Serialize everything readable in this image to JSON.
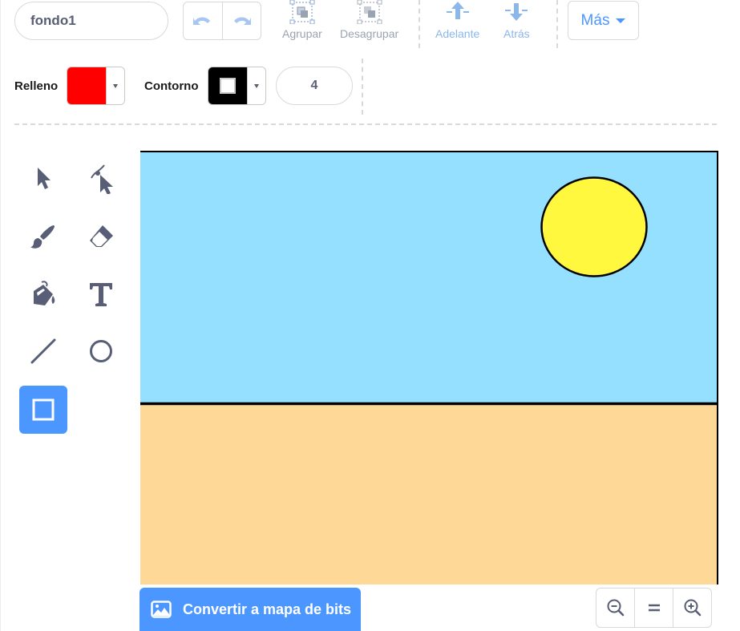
{
  "costume": {
    "name": "fondo1"
  },
  "toolbar": {
    "undo_icon": "undo-icon",
    "redo_icon": "redo-icon",
    "group_label": "Agrupar",
    "ungroup_label": "Desagrupar",
    "forward_label": "Adelante",
    "backward_label": "Atrás",
    "more_label": "Más"
  },
  "style": {
    "fill_label": "Relleno",
    "fill_color": "#ff0000",
    "outline_label": "Contorno",
    "outline_color": "#000000",
    "outline_width": "4"
  },
  "tools": [
    {
      "name": "select",
      "icon": "select-arrow-icon",
      "selected": false
    },
    {
      "name": "reshape",
      "icon": "reshape-icon",
      "selected": false
    },
    {
      "name": "brush",
      "icon": "brush-icon",
      "selected": false
    },
    {
      "name": "eraser",
      "icon": "eraser-icon",
      "selected": false
    },
    {
      "name": "fill",
      "icon": "fill-bucket-icon",
      "selected": false
    },
    {
      "name": "text",
      "icon": "text-icon",
      "selected": false
    },
    {
      "name": "line",
      "icon": "line-icon",
      "selected": false
    },
    {
      "name": "circle",
      "icon": "circle-icon",
      "selected": false
    },
    {
      "name": "rectangle",
      "icon": "rectangle-icon",
      "selected": true
    }
  ],
  "canvas": {
    "sky_color": "#96e0ff",
    "sand_color": "#fed896",
    "sun_color": "#fff83e"
  },
  "bottom": {
    "convert_label": "Convertir a mapa de bits",
    "zoom_out_icon": "zoom-out-icon",
    "zoom_reset_icon": "zoom-reset-icon",
    "zoom_in_icon": "zoom-in-icon"
  },
  "colors": {
    "accent": "#4c97ff",
    "text": "#575e75"
  }
}
